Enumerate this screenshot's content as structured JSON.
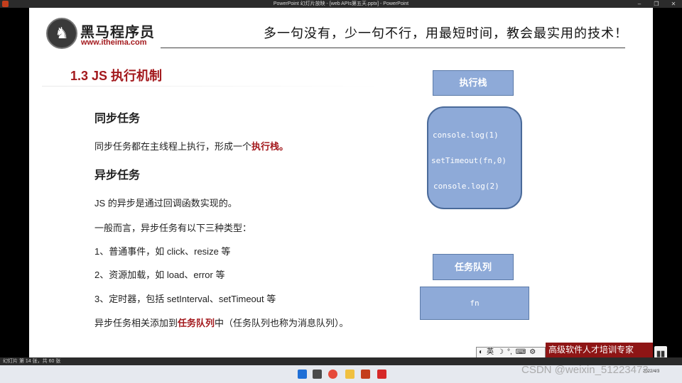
{
  "window": {
    "title": "PowerPoint 幻灯片放映 - [web APIs第五天.pptx] - PowerPoint",
    "minimize_glyph": "–",
    "restore_glyph": "❐",
    "close_glyph": "✕"
  },
  "slide": {
    "logo_brand": "黑马程序员",
    "logo_url": "www.itheima.com",
    "slogan": "多一句没有，少一句不行，用最短时间，教会最实用的技术！",
    "section_title": "1.3 JS 执行机制",
    "sync_heading": "同步任务",
    "sync_text": "同步任务都在主线程上执行，形成一个",
    "sync_highlight": "执行栈。",
    "async_heading": "异步任务",
    "async_intro": "JS 的异步是通过回调函数实现的。",
    "async_types_intro": "一般而言，异步任务有以下三种类型：",
    "async_type_items": [
      "1、普通事件，如 click、resize 等",
      "2、资源加载，如 load、error 等",
      "3、定时器，包括 setInterval、setTimeout 等"
    ],
    "queue_text_before": "异步任务相关添加到",
    "queue_highlight": "任务队列",
    "queue_text_after": "中（任务队列也称为消息队列）。",
    "diagram": {
      "stack_label": "执行栈",
      "stack_items": [
        "console.log(1)",
        "setTimeout(fn,0)",
        "console.log(2)"
      ],
      "queue_label": "任务队列",
      "queue_items": [
        "fn"
      ]
    },
    "promo_banner": "高级软件人才培训专家"
  },
  "ime": {
    "symbols": [
      "◐",
      "英",
      "☽",
      "°,",
      "⌨",
      "⚙"
    ]
  },
  "statusbar": {
    "slide_count": "幻灯片 第 14 张，共 60 张"
  },
  "taskbar": {
    "clock_date": "2022/4/3"
  },
  "watermark": "CSDN @weixin_51223473",
  "colors": {
    "accent_red": "#a3191d",
    "box_blue": "#8eaad8",
    "banner_red": "#8e1515"
  }
}
